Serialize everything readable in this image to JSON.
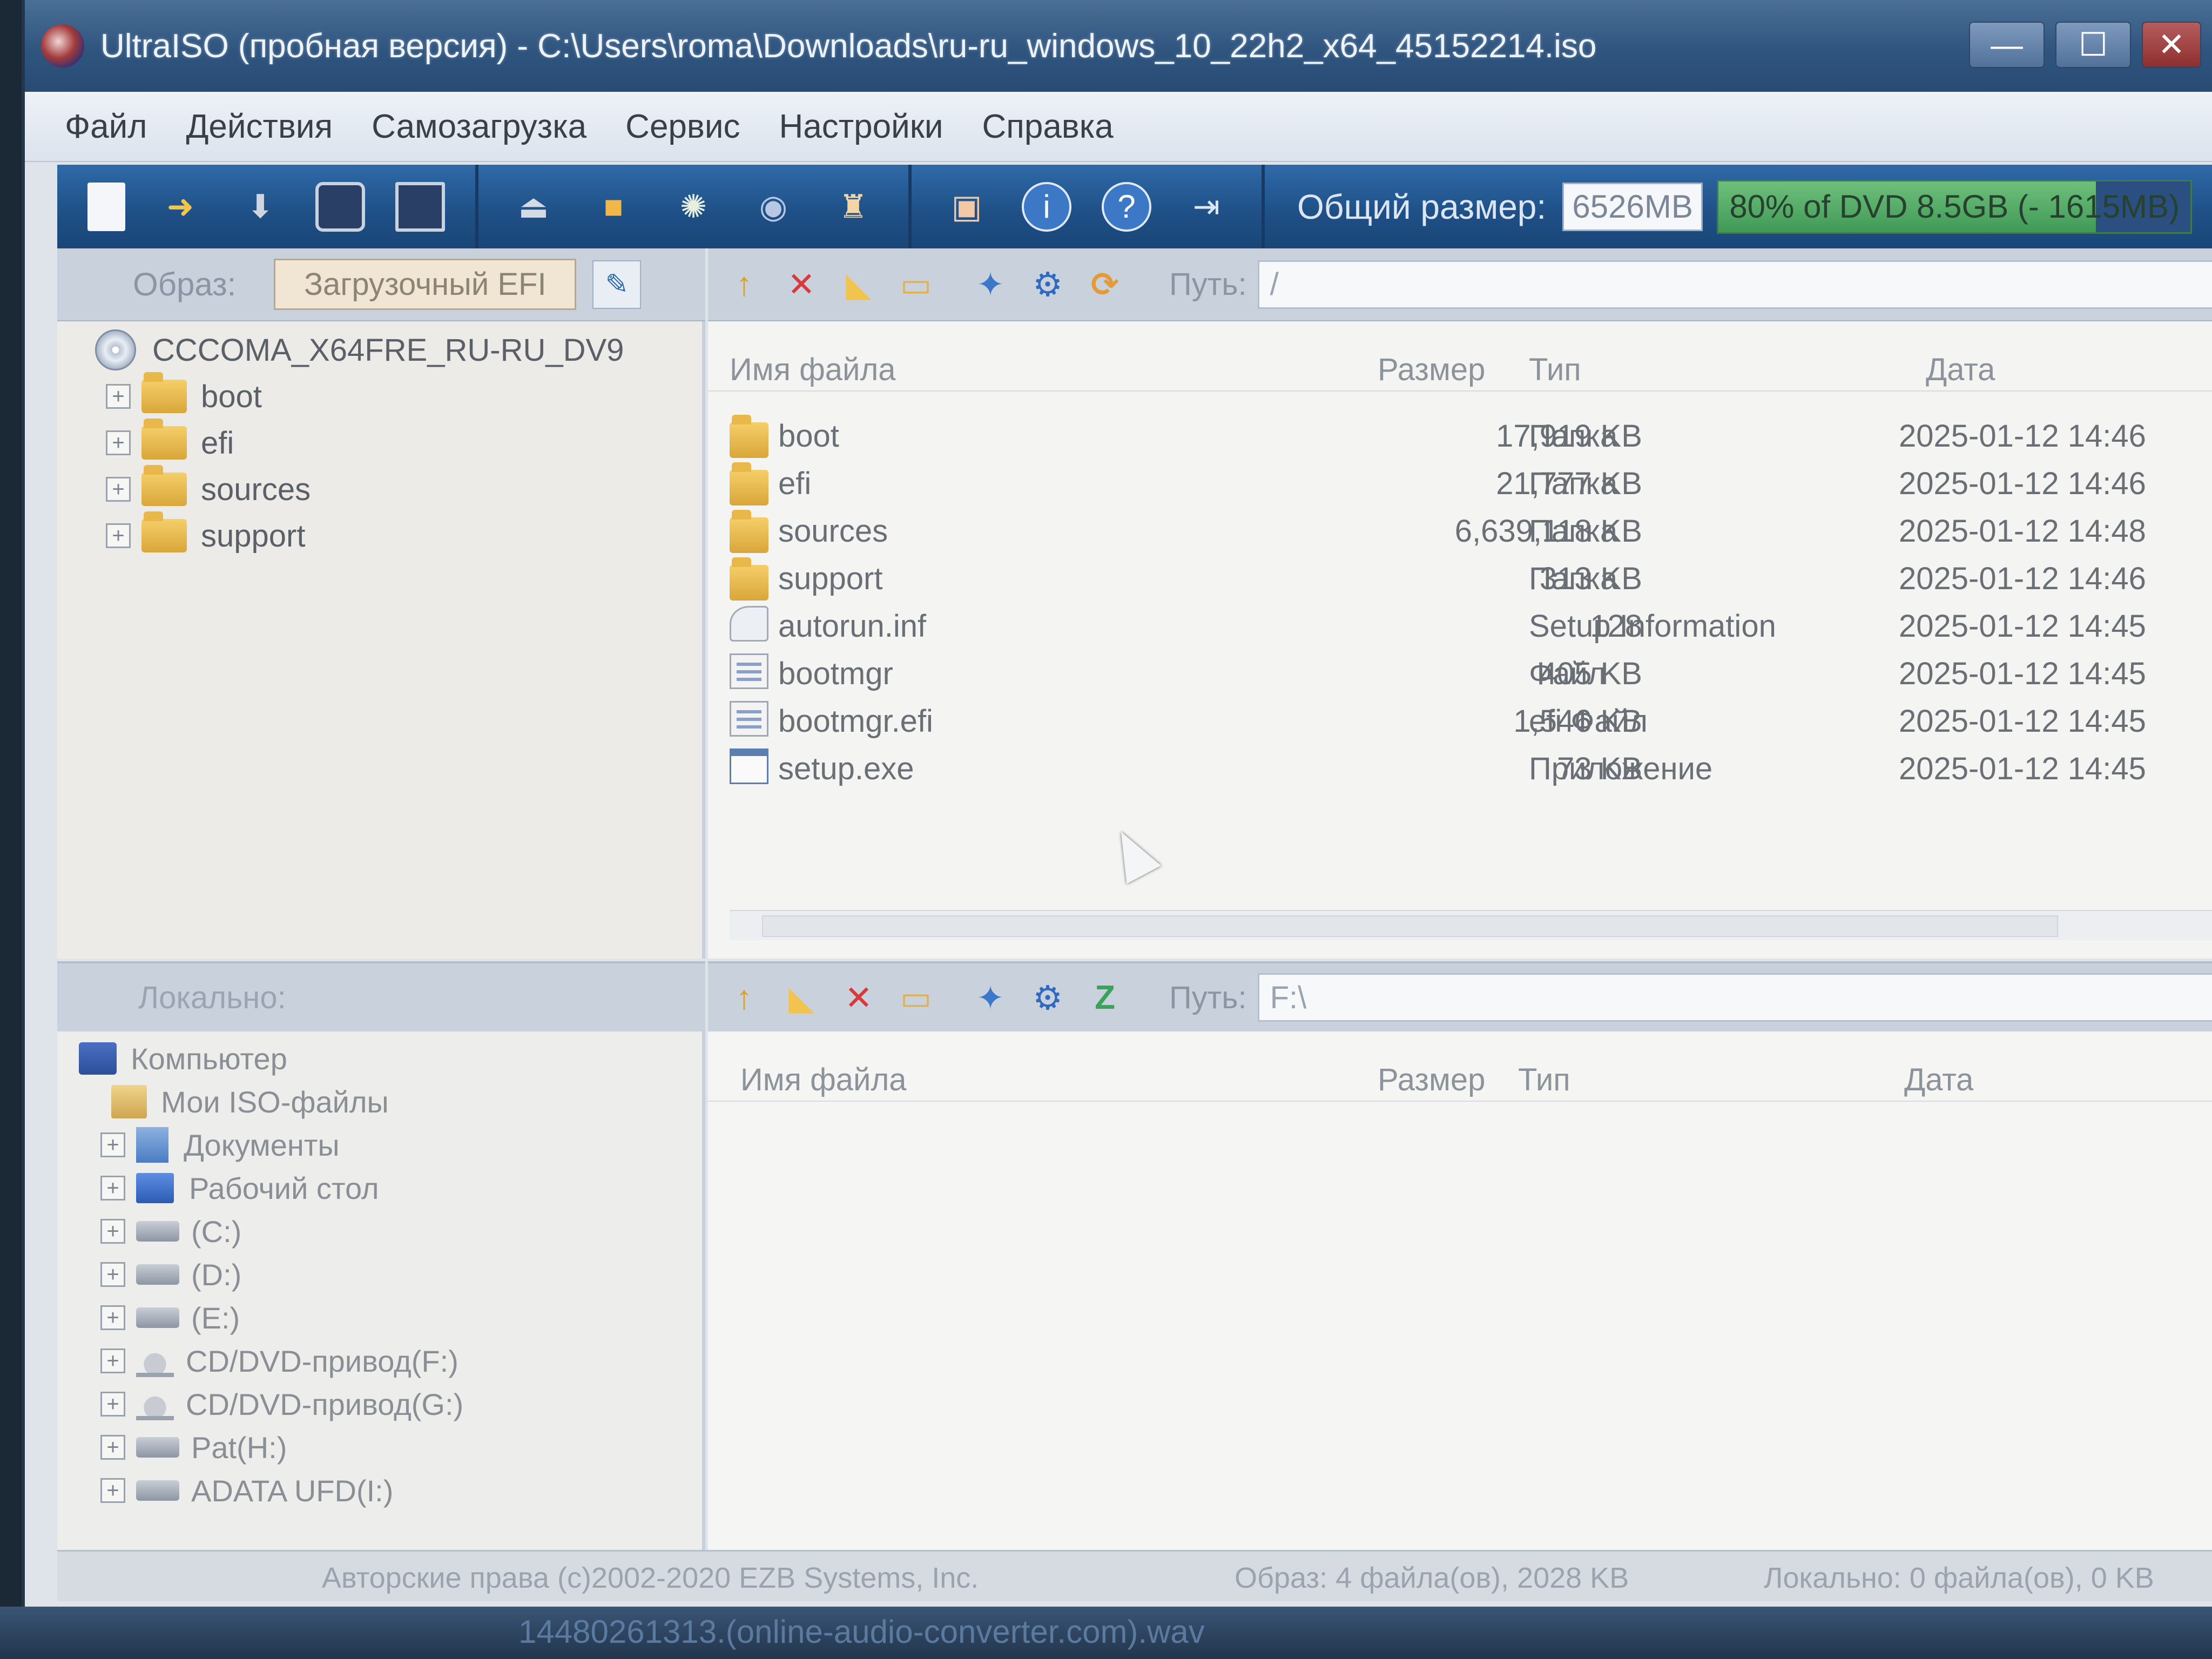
{
  "window": {
    "title": "UltraISO (пробная версия) - C:\\Users\\roma\\Downloads\\ru-ru_windows_10_22h2_x64_45152214.iso",
    "min_glyph": "—",
    "max_glyph": "☐",
    "close_glyph": "✕"
  },
  "menu": [
    "Файл",
    "Действия",
    "Самозагрузка",
    "Сервис",
    "Настройки",
    "Справка"
  ],
  "toolbar": {
    "total_size_label": "Общий размер:",
    "total_size_value": "6526MB",
    "capacity_text": "80% of DVD 8.5GB (- 1615MB)",
    "capacity_fraction": 0.8
  },
  "image_pane": {
    "label": "Образ:",
    "boot_type": "Загрузочный EFI",
    "root": "CCCOMA_X64FRE_RU-RU_DV9",
    "folders": [
      "boot",
      "efi",
      "sources",
      "support"
    ]
  },
  "iso_files": {
    "path_label": "Путь:",
    "path_value": "/",
    "columns": {
      "name": "Имя файла",
      "size": "Размер",
      "type": "Тип",
      "date": "Дата"
    },
    "rows": [
      {
        "name": "boot",
        "size": "17,919 KB",
        "type": "Папка",
        "date": "2025-01-12 14:46",
        "icon": "folder-icon"
      },
      {
        "name": "efi",
        "size": "21,777 KB",
        "type": "Папка",
        "date": "2025-01-12 14:46",
        "icon": "folder-icon"
      },
      {
        "name": "sources",
        "size": "6,639,118 KB",
        "type": "Папка",
        "date": "2025-01-12 14:48",
        "icon": "folder-icon"
      },
      {
        "name": "support",
        "size": "313 KB",
        "type": "Папка",
        "date": "2025-01-12 14:46",
        "icon": "folder-icon"
      },
      {
        "name": "autorun.inf",
        "size": "128",
        "type": "Setup Information",
        "date": "2025-01-12 14:45",
        "icon": "settings-file-icon"
      },
      {
        "name": "bootmgr",
        "size": "405 KB",
        "type": "Файл",
        "date": "2025-01-12 14:45",
        "icon": "file-icon"
      },
      {
        "name": "bootmgr.efi",
        "size": "1,546 KB",
        "type": "efi Файл",
        "date": "2025-01-12 14:45",
        "icon": "file-icon"
      },
      {
        "name": "setup.exe",
        "size": "73 KB",
        "type": "Приложение",
        "date": "2025-01-12 14:45",
        "icon": "application-icon"
      }
    ]
  },
  "local_pane": {
    "label": "Локально:",
    "tree": [
      {
        "label": "Компьютер",
        "icon": "computer-icon"
      },
      {
        "label": "Мои ISO-файлы",
        "icon": "iso-folder-icon"
      },
      {
        "label": "Документы",
        "icon": "documents-icon"
      },
      {
        "label": "Рабочий стол",
        "icon": "desktop-icon"
      },
      {
        "label": "(C:)",
        "icon": "drive-icon"
      },
      {
        "label": "(D:)",
        "icon": "drive-icon"
      },
      {
        "label": "(E:)",
        "icon": "drive-icon"
      },
      {
        "label": "CD/DVD-привод(F:)",
        "icon": "cd-drive-icon"
      },
      {
        "label": "CD/DVD-привод(G:)",
        "icon": "cd-drive-icon"
      },
      {
        "label": "Pat(H:)",
        "icon": "drive-icon"
      },
      {
        "label": "ADATA UFD(I:)",
        "icon": "drive-icon"
      }
    ],
    "path_label": "Путь:",
    "path_value": "F:\\",
    "columns": {
      "name": "Имя файла",
      "size": "Размер",
      "type": "Тип",
      "date": "Дата"
    }
  },
  "status": {
    "copyright": "Авторские права (c)2002-2020 EZB Systems, Inc.",
    "image_info": "Образ: 4 файла(ов), 2028 KB",
    "local_info": "Локально: 0 файла(ов), 0 KB"
  },
  "taskbar": {
    "text": "14480261313.(online-audio-converter.com).wav"
  }
}
